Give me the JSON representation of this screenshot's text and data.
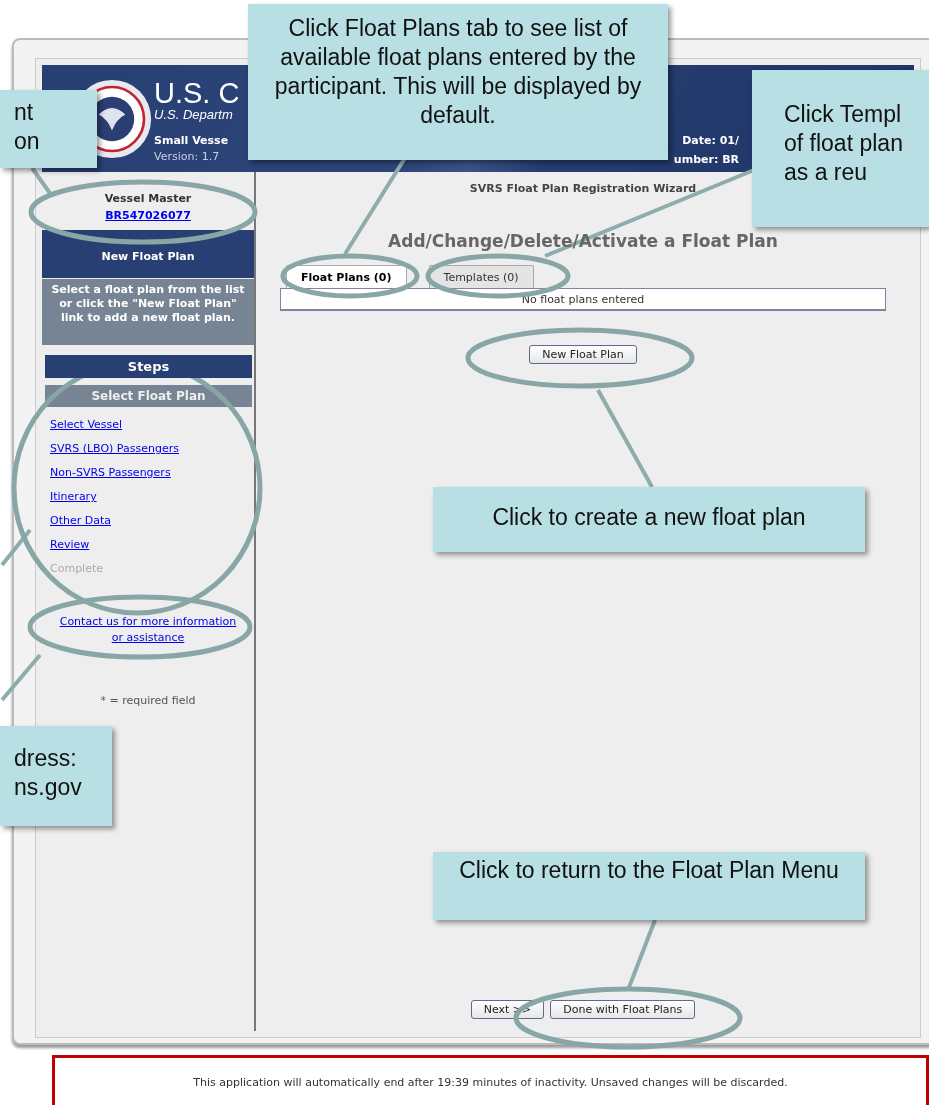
{
  "header": {
    "title": "U.S. C",
    "subtitle": "U.S. Departm",
    "app_name": "Small Vesse",
    "version": "Version: 1.7",
    "date": "Date: 01/",
    "number": "umber: BR"
  },
  "sidebar": {
    "role": "Vessel Master",
    "account_link": "BR547026077",
    "section_title": "New Float Plan",
    "instructions": "Select a float plan from the list or click the \"New Float Plan\" link to add a new float plan.",
    "steps_title": "Steps",
    "steps": [
      {
        "label": "Select Float Plan",
        "kind": "current"
      },
      {
        "label": "Select Vessel",
        "kind": "link"
      },
      {
        "label": "SVRS (LBO) Passengers",
        "kind": "link"
      },
      {
        "label": "Non-SVRS Passengers",
        "kind": "link"
      },
      {
        "label": "Itinerary",
        "kind": "link"
      },
      {
        "label": "Other Data",
        "kind": "link"
      },
      {
        "label": "Review",
        "kind": "link"
      },
      {
        "label": "Complete",
        "kind": "disabled"
      }
    ],
    "contact_link": "Contact us for more information or assistance",
    "required_note": "* = required field"
  },
  "main": {
    "wizard_title": "SVRS Float Plan Registration Wizard",
    "heading": "Add/Change/Delete/Activate a Float Plan",
    "tabs": [
      {
        "label": "Float Plans (0)",
        "selected": true
      },
      {
        "label": "Templates (0)",
        "selected": false
      }
    ],
    "empty_message": "No float plans entered",
    "new_button": "New Float Plan",
    "buttons": [
      "Next >>",
      "Done with Float Plans"
    ]
  },
  "footer": {
    "message": "This application will automatically end after 19:39 minutes of inactivity. Unsaved changes will be discarded."
  },
  "callouts": [
    {
      "text": "nt\non"
    },
    {
      "text": "Click Float Plans tab to see list of available float plans entered by the participant. This will be displayed by default."
    },
    {
      "text": "Click Templ\nof float plan\nas a reu"
    },
    {
      "text": "Click to create a new float plan"
    },
    {
      "text": "dress:\nns.gov"
    },
    {
      "text": "Click to return to the Float Plan Menu"
    }
  ]
}
